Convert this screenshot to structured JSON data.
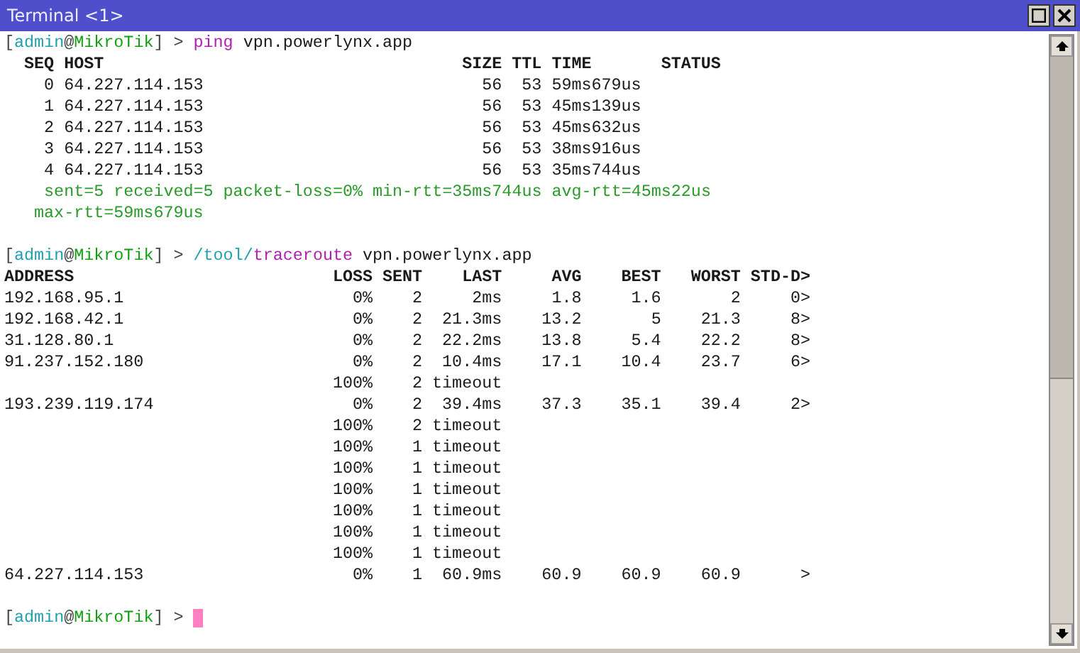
{
  "window": {
    "title": "Terminal <1>"
  },
  "ping": {
    "prompt": [
      {
        "text": "[",
        "kind": "punct"
      },
      {
        "text": "admin",
        "kind": "user"
      },
      {
        "text": "@",
        "kind": "punct"
      },
      {
        "text": "MikroTik",
        "kind": "host"
      },
      {
        "text": "] >",
        "kind": "punct"
      }
    ],
    "command": [
      {
        "text": "ping",
        "kind": "command"
      },
      {
        "text": "vpn.powerlynx.app",
        "kind": "arg"
      }
    ],
    "columns": [
      "SEQ",
      "HOST",
      "SIZE",
      "TTL",
      "TIME",
      "STATUS"
    ],
    "rows": [
      {
        "seq": "0",
        "host": "64.227.114.153",
        "size": "56",
        "ttl": "53",
        "time": "59ms679us"
      },
      {
        "seq": "1",
        "host": "64.227.114.153",
        "size": "56",
        "ttl": "53",
        "time": "45ms139us"
      },
      {
        "seq": "2",
        "host": "64.227.114.153",
        "size": "56",
        "ttl": "53",
        "time": "45ms632us"
      },
      {
        "seq": "3",
        "host": "64.227.114.153",
        "size": "56",
        "ttl": "53",
        "time": "38ms916us"
      },
      {
        "seq": "4",
        "host": "64.227.114.153",
        "size": "56",
        "ttl": "53",
        "time": "35ms744us"
      }
    ],
    "summary": [
      "sent=5 received=5 packet-loss=0% min-rtt=35ms744us avg-rtt=45ms22us",
      "max-rtt=59ms679us"
    ]
  },
  "traceroute": {
    "prompt": [
      {
        "text": "[",
        "kind": "punct"
      },
      {
        "text": "admin",
        "kind": "user"
      },
      {
        "text": "@",
        "kind": "punct"
      },
      {
        "text": "MikroTik",
        "kind": "host"
      },
      {
        "text": "] >",
        "kind": "punct"
      }
    ],
    "command": [
      {
        "text": "/tool/",
        "kind": "path"
      },
      {
        "text": "traceroute",
        "kind": "command"
      },
      {
        "text": "vpn.powerlynx.app",
        "kind": "arg"
      }
    ],
    "columns": [
      "ADDRESS",
      "LOSS",
      "SENT",
      "LAST",
      "AVG",
      "BEST",
      "WORST",
      "STD-D>"
    ],
    "rows": [
      {
        "address": "192.168.95.1",
        "loss": "0%",
        "sent": "2",
        "last": "2ms",
        "avg": "1.8",
        "best": "1.6",
        "worst": "2",
        "std": "0>"
      },
      {
        "address": "192.168.42.1",
        "loss": "0%",
        "sent": "2",
        "last": "21.3ms",
        "avg": "13.2",
        "best": "5",
        "worst": "21.3",
        "std": "8>"
      },
      {
        "address": "31.128.80.1",
        "loss": "0%",
        "sent": "2",
        "last": "22.2ms",
        "avg": "13.8",
        "best": "5.4",
        "worst": "22.2",
        "std": "8>"
      },
      {
        "address": "91.237.152.180",
        "loss": "0%",
        "sent": "2",
        "last": "10.4ms",
        "avg": "17.1",
        "best": "10.4",
        "worst": "23.7",
        "std": "6>"
      },
      {
        "loss": "100%",
        "sent": "2",
        "last": "timeout"
      },
      {
        "address": "193.239.119.174",
        "loss": "0%",
        "sent": "2",
        "last": "39.4ms",
        "avg": "37.3",
        "best": "35.1",
        "worst": "39.4",
        "std": "2>"
      },
      {
        "loss": "100%",
        "sent": "2",
        "last": "timeout"
      },
      {
        "loss": "100%",
        "sent": "1",
        "last": "timeout"
      },
      {
        "loss": "100%",
        "sent": "1",
        "last": "timeout"
      },
      {
        "loss": "100%",
        "sent": "1",
        "last": "timeout"
      },
      {
        "loss": "100%",
        "sent": "1",
        "last": "timeout"
      },
      {
        "loss": "100%",
        "sent": "1",
        "last": "timeout"
      },
      {
        "loss": "100%",
        "sent": "1",
        "last": "timeout"
      },
      {
        "address": "64.227.114.153",
        "loss": "0%",
        "sent": "1",
        "last": "60.9ms",
        "avg": "60.9",
        "best": "60.9",
        "worst": "60.9",
        "std": ">"
      }
    ]
  },
  "final_prompt": {
    "prompt": [
      {
        "text": "[",
        "kind": "punct"
      },
      {
        "text": "admin",
        "kind": "user"
      },
      {
        "text": "@",
        "kind": "punct"
      },
      {
        "text": "MikroTik",
        "kind": "host"
      },
      {
        "text": "] >",
        "kind": "punct"
      }
    ],
    "cursor": true
  }
}
